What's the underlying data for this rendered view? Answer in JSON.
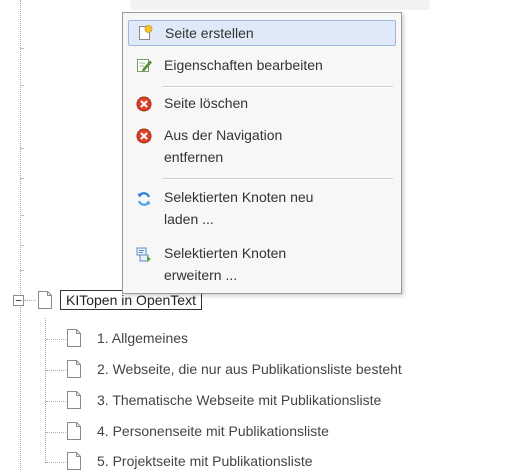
{
  "context_menu": {
    "items": [
      {
        "label": "Seite erstellen",
        "icon": "new-page-icon"
      },
      {
        "label": "Eigenschaften bearbeiten",
        "icon": "edit-properties-icon"
      },
      {
        "label": "Seite löschen",
        "icon": "delete-icon"
      },
      {
        "label_line1": "Aus der Navigation",
        "label_line2": "entfernen",
        "icon": "remove-icon"
      },
      {
        "label_line1": "Selektierten Knoten neu",
        "label_line2": "laden ...",
        "icon": "refresh-icon"
      },
      {
        "label_line1": "Selektierten Knoten",
        "label_line2": "erweitern ...",
        "icon": "expand-node-icon"
      }
    ]
  },
  "tree": {
    "root": {
      "label": "KITopen in OpenText",
      "expander": "−"
    },
    "children": [
      {
        "label": "1. Allgemeines"
      },
      {
        "label": "2. Webseite, die nur aus Publikationsliste besteht"
      },
      {
        "label": "3. Thematische Webseite mit Publikationsliste"
      },
      {
        "label": "4. Personenseite mit Publikationsliste"
      },
      {
        "label": "5. Projektseite mit Publikationsliste"
      }
    ]
  },
  "colors": {
    "menu_highlight": "#dfe9f7",
    "delete_red": "#d9432b",
    "refresh_blue": "#2b7fd4",
    "edit_green": "#5aa33a"
  }
}
